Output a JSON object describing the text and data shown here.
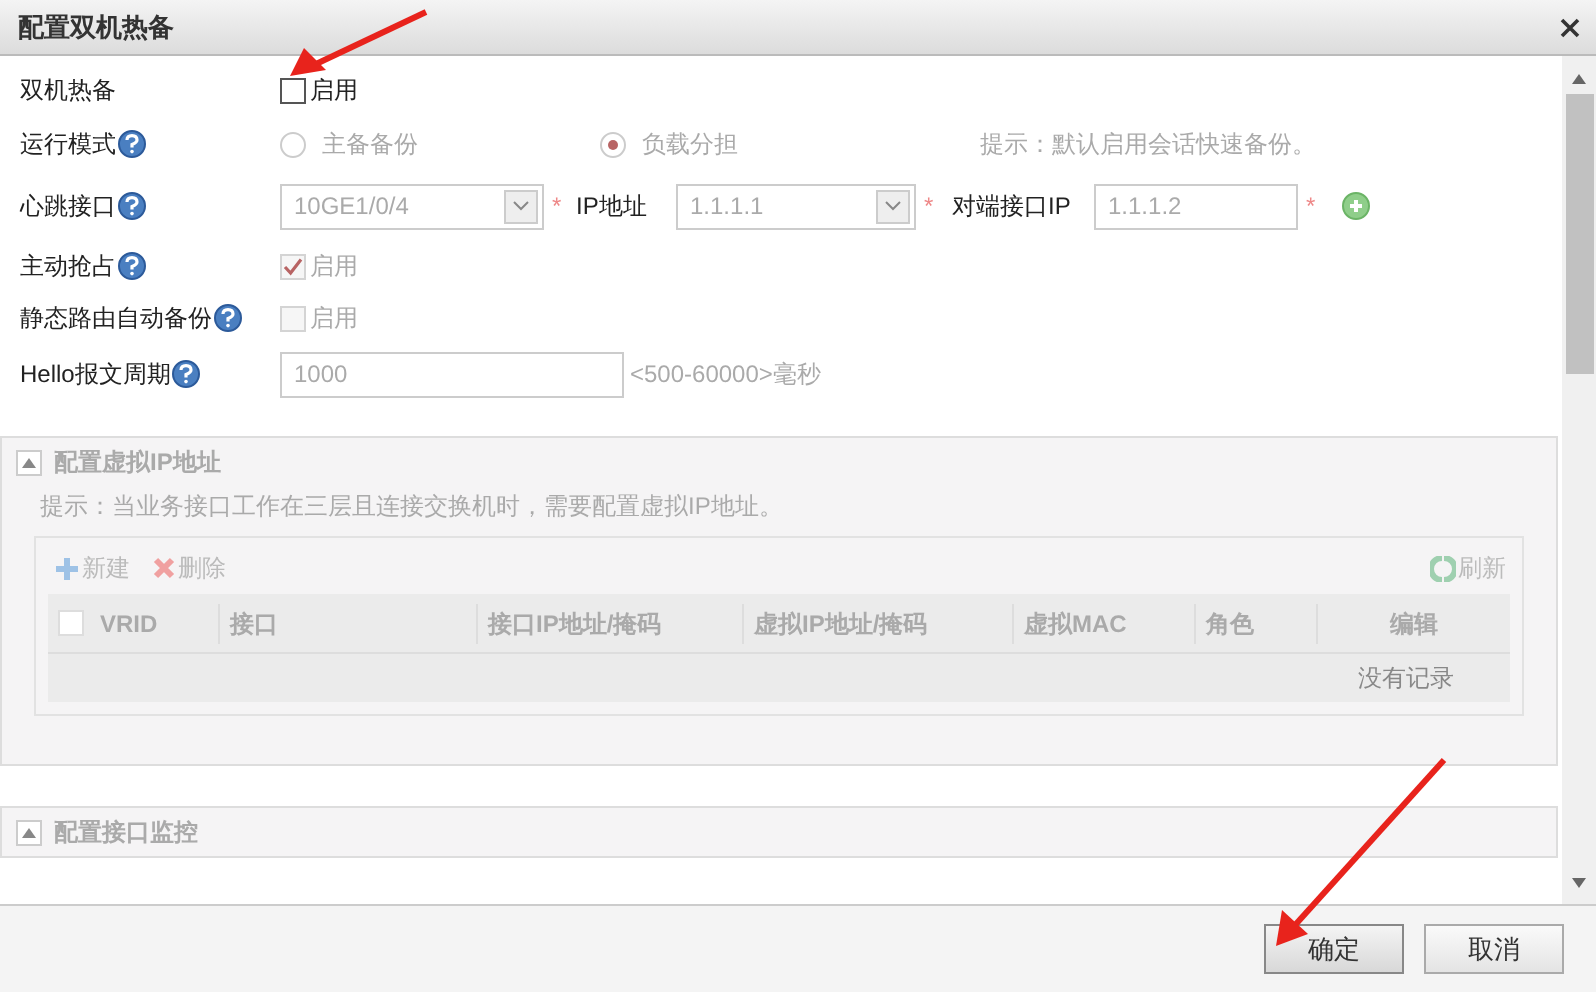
{
  "window": {
    "title": "配置双机热备"
  },
  "form": [
    {
      "kind": "checkbox",
      "label": "双机热备",
      "help": false,
      "checkbox_label": "启用",
      "checked": false,
      "disabled": false
    },
    {
      "kind": "radio",
      "label": "运行模式",
      "help": true,
      "options": [
        {
          "label": "主备备份",
          "selected": false
        },
        {
          "label": "负载分担",
          "selected": true
        }
      ],
      "hint": "提示：默认启用会话快速备份。"
    },
    {
      "kind": "heartbeat",
      "label": "心跳接口",
      "help": true,
      "interface": "10GE1/0/4",
      "required": "*",
      "ip_label": "IP地址",
      "ip_value": "1.1.1.1",
      "peer_label": "对端接口IP",
      "peer_value": "1.1.1.2"
    },
    {
      "kind": "checkbox",
      "label": "主动抢占",
      "help": true,
      "checkbox_label": "启用",
      "checked": true,
      "disabled": true
    },
    {
      "kind": "checkbox",
      "label": "静态路由自动备份",
      "help": true,
      "checkbox_label": "启用",
      "checked": false,
      "disabled": true
    },
    {
      "kind": "input",
      "label": "Hello报文周期",
      "help": true,
      "value": "1000",
      "range": "<500-60000>毫秒"
    }
  ],
  "sections": [
    {
      "title": "配置虚拟IP地址",
      "hint": "提示：当业务接口工作在三层且连接交换机时，需要配置虚拟IP地址。",
      "toolbar": {
        "new": "新建",
        "delete": "删除",
        "refresh": "刷新"
      },
      "table": {
        "select_all_checked": false,
        "columns": [
          "VRID",
          "接口",
          "接口IP地址/掩码",
          "虚拟IP地址/掩码",
          "虚拟MAC",
          "角色",
          "编辑"
        ],
        "empty": "没有记录"
      }
    },
    {
      "title": "配置接口监控"
    }
  ],
  "buttons": [
    {
      "label": "确定",
      "focused": true
    },
    {
      "label": "取消",
      "focused": false
    }
  ]
}
